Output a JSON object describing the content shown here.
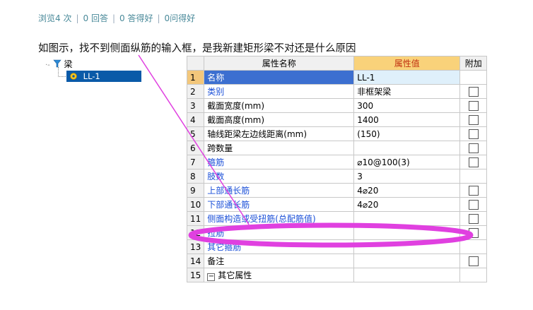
{
  "stats": {
    "views": "浏览4 次",
    "answers": "0 回答",
    "good": "0 答得好",
    "asked_good": "0问得好",
    "separator": "|"
  },
  "question": "如图示，找不到侧面纵筋的输入框，是我新建矩形梁不对还是什么原因",
  "tree": {
    "root_label": "梁",
    "child_label": "LL-1"
  },
  "grid": {
    "headers": {
      "name": "属性名称",
      "value": "属性值",
      "extra": "附加"
    },
    "rows": [
      {
        "num": "1",
        "name": "名称",
        "value": "LL-1",
        "blue": true,
        "checkbox": false
      },
      {
        "num": "2",
        "name": "类别",
        "value": "非框架梁",
        "blue": true,
        "checkbox": true
      },
      {
        "num": "3",
        "name": "截面宽度(mm)",
        "value": "300",
        "blue": false,
        "checkbox": true
      },
      {
        "num": "4",
        "name": "截面高度(mm)",
        "value": "1400",
        "blue": false,
        "checkbox": true
      },
      {
        "num": "5",
        "name": "轴线距梁左边线距离(mm)",
        "value": "(150)",
        "blue": false,
        "checkbox": true
      },
      {
        "num": "6",
        "name": "跨数量",
        "value": "",
        "blue": false,
        "checkbox": true
      },
      {
        "num": "7",
        "name": "箍筋",
        "value": "⌀10@100(3)",
        "blue": true,
        "checkbox": true
      },
      {
        "num": "8",
        "name": "肢数",
        "value": "3",
        "blue": true,
        "checkbox": false
      },
      {
        "num": "9",
        "name": "上部通长筋",
        "value": "4⌀20",
        "blue": true,
        "checkbox": true
      },
      {
        "num": "10",
        "name": "下部通长筋",
        "value": "4⌀20",
        "blue": true,
        "checkbox": true
      },
      {
        "num": "11",
        "name": "侧面构造或受扭筋(总配筋值)",
        "value": "",
        "blue": true,
        "checkbox": true
      },
      {
        "num": "12",
        "name": "拉筋",
        "value": "",
        "blue": true,
        "checkbox": true
      },
      {
        "num": "13",
        "name": "其它箍筋",
        "value": "",
        "blue": true,
        "checkbox": false
      },
      {
        "num": "14",
        "name": "备注",
        "value": "",
        "blue": false,
        "checkbox": true
      },
      {
        "num": "15",
        "name": "其它属性",
        "value": "",
        "blue": false,
        "checkbox": false
      }
    ]
  },
  "colors": {
    "annotation": "#e040e0",
    "header_value_bg": "#f9d27a",
    "selection_blue": "#0a5aa8"
  }
}
